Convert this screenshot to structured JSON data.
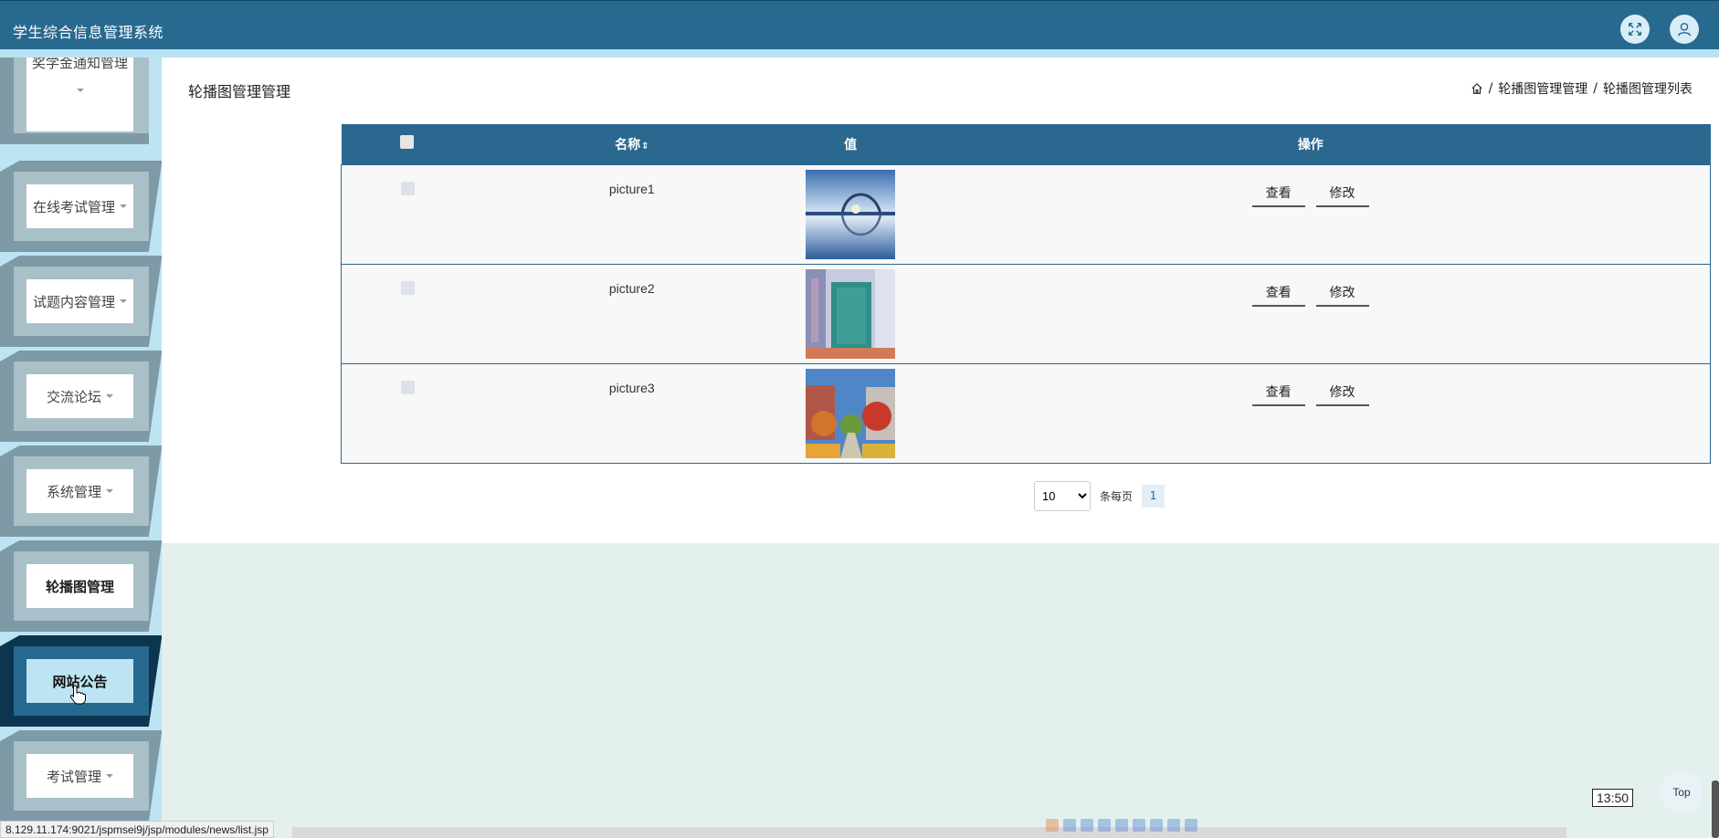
{
  "header": {
    "app_title": "学生综合信息管理系统",
    "fullscreen_icon": "expand-icon",
    "user_icon": "user-icon"
  },
  "sidebar": {
    "items": [
      {
        "label": "奖学金通知管理",
        "has_caret": true
      },
      {
        "label": "在线考试管理",
        "has_caret": true
      },
      {
        "label": "试题内容管理",
        "has_caret": true
      },
      {
        "label": "交流论坛",
        "has_caret": true
      },
      {
        "label": "系统管理",
        "has_caret": true
      },
      {
        "label": "轮播图管理",
        "has_caret": false
      },
      {
        "label": "网站公告",
        "has_caret": false,
        "hovered": true
      },
      {
        "label": "考试管理",
        "has_caret": true
      }
    ]
  },
  "page": {
    "title": "轮播图管理管理",
    "breadcrumb": {
      "home_icon": "home-icon",
      "separator": "/",
      "items": [
        "轮播图管理管理",
        "轮播图管理列表"
      ]
    }
  },
  "table": {
    "headers": {
      "select": "",
      "name": "名称",
      "name_sort_icon": "sort-icon",
      "value": "值",
      "actions": "操作"
    },
    "rows": [
      {
        "name": "picture1",
        "thumb": "bridge-lake-image",
        "view_label": "查看",
        "edit_label": "修改"
      },
      {
        "name": "picture2",
        "thumb": "building-hall-image",
        "view_label": "查看",
        "edit_label": "修改"
      },
      {
        "name": "picture3",
        "thumb": "campus-autumn-image",
        "view_label": "查看",
        "edit_label": "修改"
      }
    ]
  },
  "pager": {
    "page_size": "10",
    "page_size_options": [
      "10"
    ],
    "per_page_label": "条每页",
    "current_page": "1"
  },
  "misc": {
    "status_url": "8.129.11.174:9021/jspmsei9j/jsp/modules/news/list.jsp",
    "clock": "13:50",
    "top_label": "Top"
  },
  "colors": {
    "primary": "#28698f",
    "strip": "#b9e3f2",
    "sidebar_bg": "#bde4f3",
    "page_bg": "#e3f0ed"
  }
}
